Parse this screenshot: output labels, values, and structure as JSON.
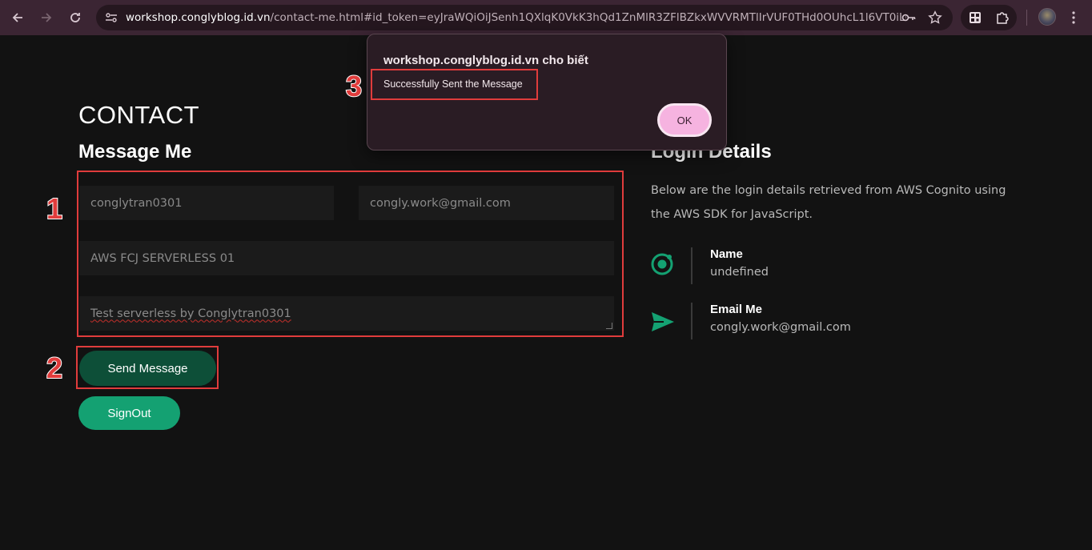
{
  "browser": {
    "back_icon": "arrow-left-icon",
    "forward_icon": "arrow-right-icon",
    "reload_icon": "reload-icon",
    "url_domain": "workshop.conglyblog.id.vn",
    "url_path": "/contact-me.html#id_token=eyJraWQiOiJSenh1QXlqK0VkK3hQd1ZnMlR3ZFlBZkxWVVRMTlIrVUF0THd0OUhcL1l6VT0iLCJhbGci..."
  },
  "page": {
    "title": "CONTACT",
    "form_title": "Message Me",
    "form": {
      "name": "conglytran0301",
      "email": "congly.work@gmail.com",
      "subject": "AWS FCJ SERVERLESS 01",
      "message": "Test serverless by Conglytran0301"
    },
    "send_button": "Send Message",
    "signout_button": "SignOut"
  },
  "login": {
    "title": "Login Details",
    "description": "Below are the login details retrieved from AWS Cognito using the AWS SDK for JavaScript.",
    "name_label": "Name",
    "name_value": "undefined",
    "email_label": "Email Me",
    "email_value": "congly.work@gmail.com"
  },
  "dialog": {
    "title": "workshop.conglyblog.id.vn cho biết",
    "message": "Successfully Sent the Message",
    "ok": "OK"
  },
  "annotations": {
    "one": "1",
    "two": "2",
    "three": "3"
  },
  "colors": {
    "background": "#121212",
    "accent_green": "#14a172",
    "dark_green": "#0d4f38",
    "annotation_red": "#e03c3c",
    "dialog_button_pink": "#f6b3e0"
  }
}
